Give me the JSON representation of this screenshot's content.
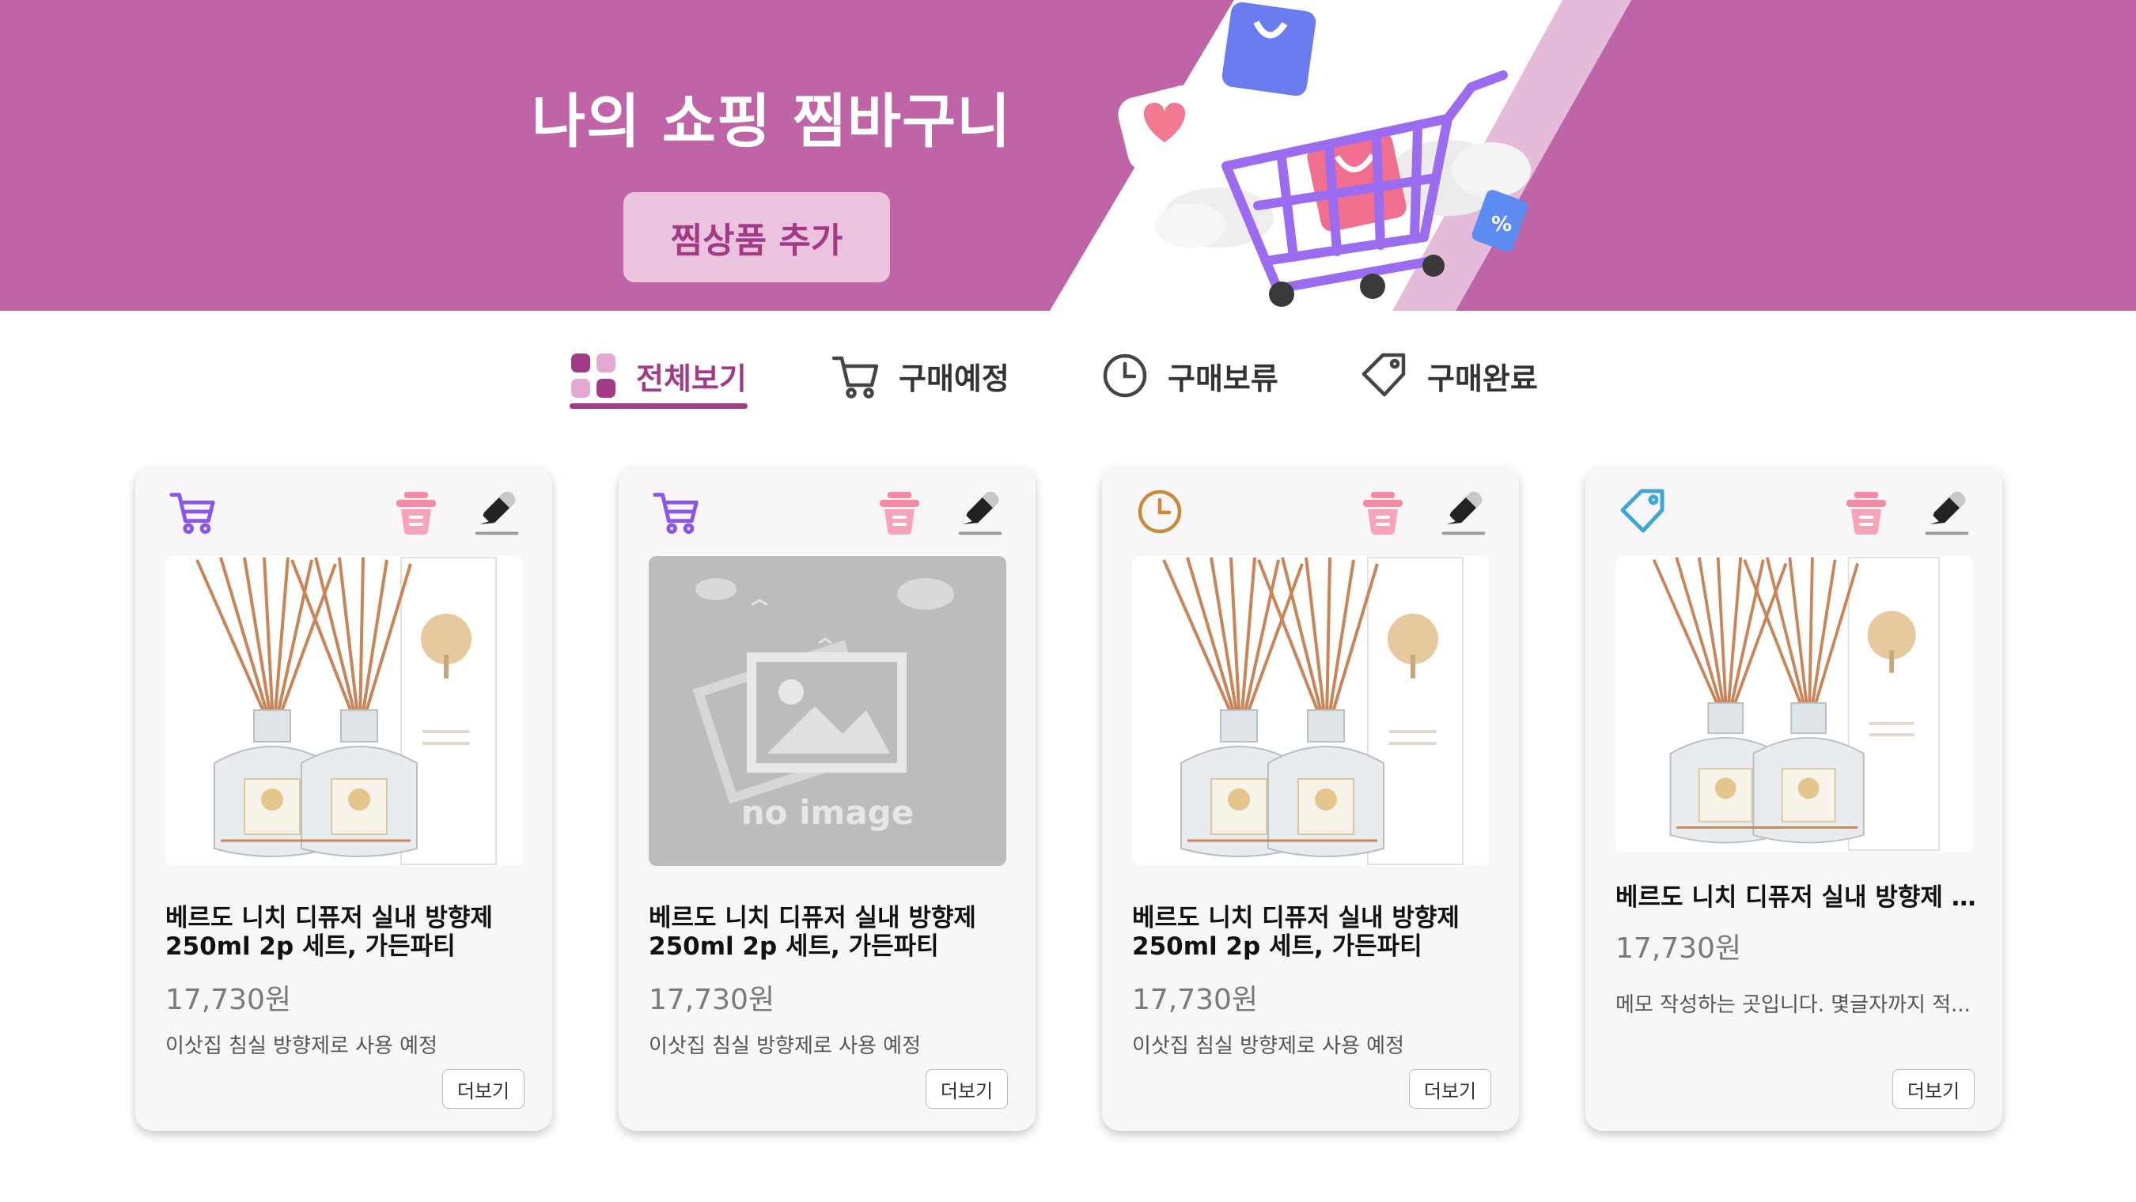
{
  "banner": {
    "title": "나의 쇼핑 찜바구니",
    "add_button": "찜상품 추가",
    "colors": {
      "background": "#bf64a6",
      "stripe": "#e4bcd9",
      "button_bg": "#ecc3df",
      "button_text": "#a23a86"
    }
  },
  "tabs": [
    {
      "label": "전체보기",
      "icon": "grid-icon",
      "active": true
    },
    {
      "label": "구매예정",
      "icon": "cart-icon",
      "active": false
    },
    {
      "label": "구매보류",
      "icon": "clock-icon",
      "active": false
    },
    {
      "label": "구매완료",
      "icon": "tag-icon",
      "active": false
    }
  ],
  "cards": [
    {
      "status": "cart-icon",
      "status_color": "#8a55e8",
      "image": "product",
      "name": "베르도 니치 디퓨저 실내 방향제 250ml 2p 세트, 가든파티",
      "price": "17,730원",
      "memo": "이삿집 침실 방향제로 사용 예정",
      "more": "더보기"
    },
    {
      "status": "cart-icon",
      "status_color": "#8a55e8",
      "image": "none",
      "no_image_text": "no image",
      "name": "베르도 니치 디퓨저 실내 방향제 250ml 2p 세트, 가든파티",
      "price": "17,730원",
      "memo": "이삿집 침실 방향제로 사용 예정",
      "more": "더보기"
    },
    {
      "status": "clock-icon",
      "status_color": "#c98a3a",
      "image": "product",
      "name": "베르도 니치 디퓨저 실내 방향제 250ml 2p 세트, 가든파티",
      "price": "17,730원",
      "memo": "이삿집 침실 방향제로 사용 예정",
      "more": "더보기"
    },
    {
      "status": "tag-icon",
      "status_color": "#3fa7d8",
      "image": "product",
      "name": "베르도 니치 디퓨저 실내 방향제 ...",
      "price": "17,730원",
      "memo": "메모 작성하는 곳입니다. 몇글자까지 적...",
      "more": "더보기"
    }
  ],
  "colors": {
    "accent": "#a23a86",
    "delete": "#f48aa4",
    "edit": "#222222"
  }
}
